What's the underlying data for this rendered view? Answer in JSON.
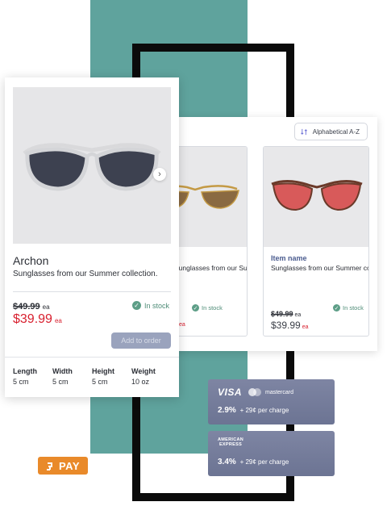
{
  "listing": {
    "sort_label": "Alphabetical A-Z",
    "products": [
      {
        "name": "",
        "desc": "Sunglasses from our Summer collection.",
        "stock": "In stock",
        "price_fragment": "ea"
      },
      {
        "name": "Item name",
        "desc": "Sunglasses from our Summer collection.",
        "stock": "In stock",
        "old_price": "$49.99",
        "new_price": "$39.99",
        "unit": "ea"
      }
    ]
  },
  "detail": {
    "title": "Archon",
    "desc": "Sunglasses from our Summer collection.",
    "old_price": "$49.99",
    "new_price": "$39.99",
    "unit": "ea",
    "stock": "In stock",
    "add_button": "Add to order",
    "next_icon": "chevron-right-icon",
    "dimensions": [
      {
        "label": "Length",
        "value": "5 cm"
      },
      {
        "label": "Width",
        "value": "5 cm"
      },
      {
        "label": "Height",
        "value": "5 cm"
      },
      {
        "label": "Weight",
        "value": "10 oz"
      }
    ]
  },
  "payments": {
    "visa": "VISA",
    "mastercard": "mastercard",
    "visa_rate": "2.9%",
    "visa_extra": "+ 29¢ per charge",
    "amex_line1": "AMERICAN",
    "amex_line2": "EXPRESS",
    "amex_rate": "3.4%",
    "amex_extra": "+ 29¢ per charge"
  },
  "pay_badge": "PAY",
  "colors": {
    "teal": "#5fa39d",
    "sale_red": "#d8202f",
    "stock_green": "#5d9e87",
    "payment_card": "#7279976",
    "pay_orange": "#e98a2a"
  }
}
